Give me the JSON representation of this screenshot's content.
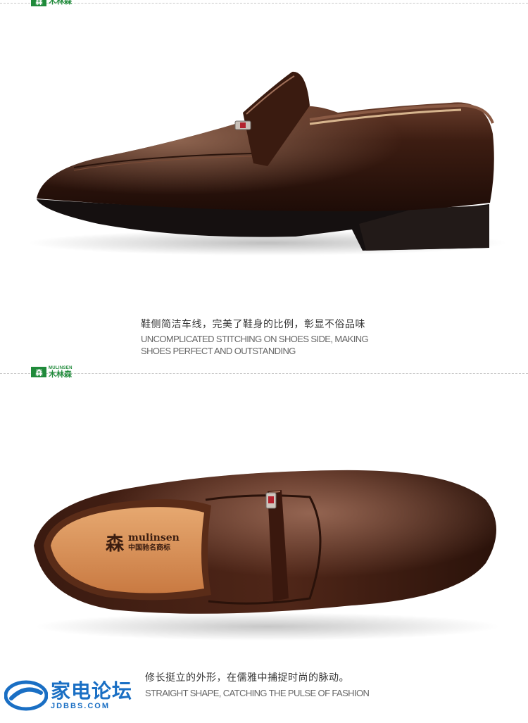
{
  "brand": {
    "logo_en": "MULINSEN",
    "logo_cn": "木林森",
    "logo_mark": "森",
    "color": "#1f8a3a"
  },
  "sections": [
    {
      "caption_cn": "鞋侧简洁车线，完美了鞋身的比例，彰显不俗品味",
      "caption_en_line1": "UNCOMPLICATED STITCHING ON SHOES SIDE, MAKING",
      "caption_en_line2": "SHOES PERFECT AND OUTSTANDING",
      "image": "brown-leather-loafer-side-view"
    },
    {
      "caption_cn": "修长挺立的外形，在儒雅中捕捉时尚的脉动。",
      "caption_en_line1": "STRAIGHT SHAPE, CATCHING THE PULSE OF FASHION",
      "image": "brown-leather-loafer-top-view",
      "insole_brand": "mulinsen",
      "insole_cn": "中国驰名商标",
      "insole_mark": "森"
    }
  ],
  "watermark": {
    "cn": "家电论坛",
    "en": "JDBBS.COM",
    "color": "#1a6fc4"
  }
}
